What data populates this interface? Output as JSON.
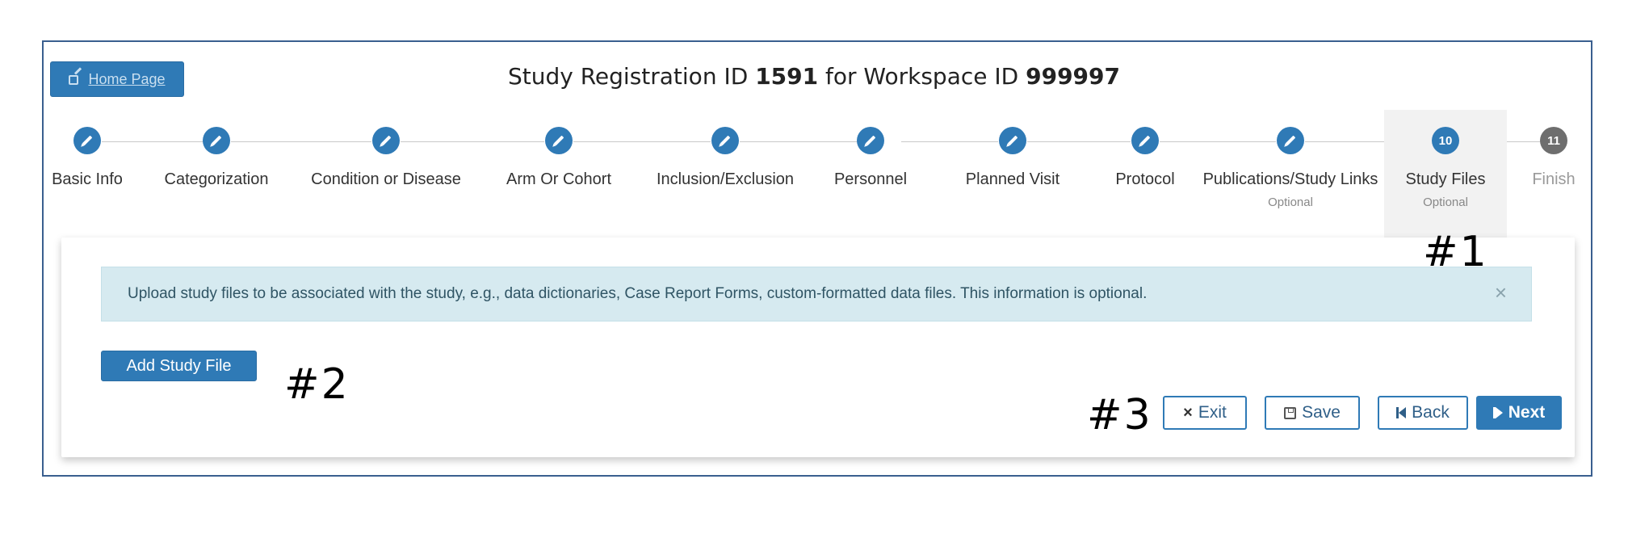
{
  "header": {
    "home_label": "Home Page",
    "title_prefix": "Study Registration ID",
    "registration_id": "1591",
    "title_middle": "for Workspace ID",
    "workspace_id": "999997"
  },
  "steps": [
    {
      "label": "Basic Info",
      "state": "complete",
      "icon": "pencil-icon"
    },
    {
      "label": "Categorization",
      "state": "complete",
      "icon": "pencil-icon"
    },
    {
      "label": "Condition or Disease",
      "state": "complete",
      "icon": "pencil-icon"
    },
    {
      "label": "Arm Or Cohort",
      "state": "complete",
      "icon": "pencil-icon"
    },
    {
      "label": "Inclusion/Exclusion",
      "state": "complete",
      "icon": "pencil-icon"
    },
    {
      "label": "Personnel",
      "state": "complete",
      "icon": "pencil-icon"
    },
    {
      "label": "Planned Visit",
      "state": "complete",
      "icon": "pencil-icon"
    },
    {
      "label": "Protocol",
      "state": "complete",
      "icon": "pencil-icon"
    },
    {
      "label": "Publications/Study Links",
      "sub": "Optional",
      "state": "complete",
      "icon": "pencil-icon"
    },
    {
      "label": "Study Files",
      "sub": "Optional",
      "number": "10",
      "state": "active"
    },
    {
      "label": "Finish",
      "number": "11",
      "state": "pending"
    }
  ],
  "alert": {
    "message": "Upload study files to be associated with the study, e.g., data dictionaries, Case Report Forms, custom-formatted data files. This information is optional.",
    "close": "×"
  },
  "actions": {
    "add_study_file": "Add Study File",
    "exit": "Exit",
    "save": "Save",
    "back": "Back",
    "next": "Next"
  },
  "annotations": {
    "one": "#1",
    "two": "#2",
    "three": "#3"
  },
  "colors": {
    "primary": "#2f7ab6",
    "alert_bg": "#d6eaf0",
    "pending_step": "#6e6e6e"
  }
}
